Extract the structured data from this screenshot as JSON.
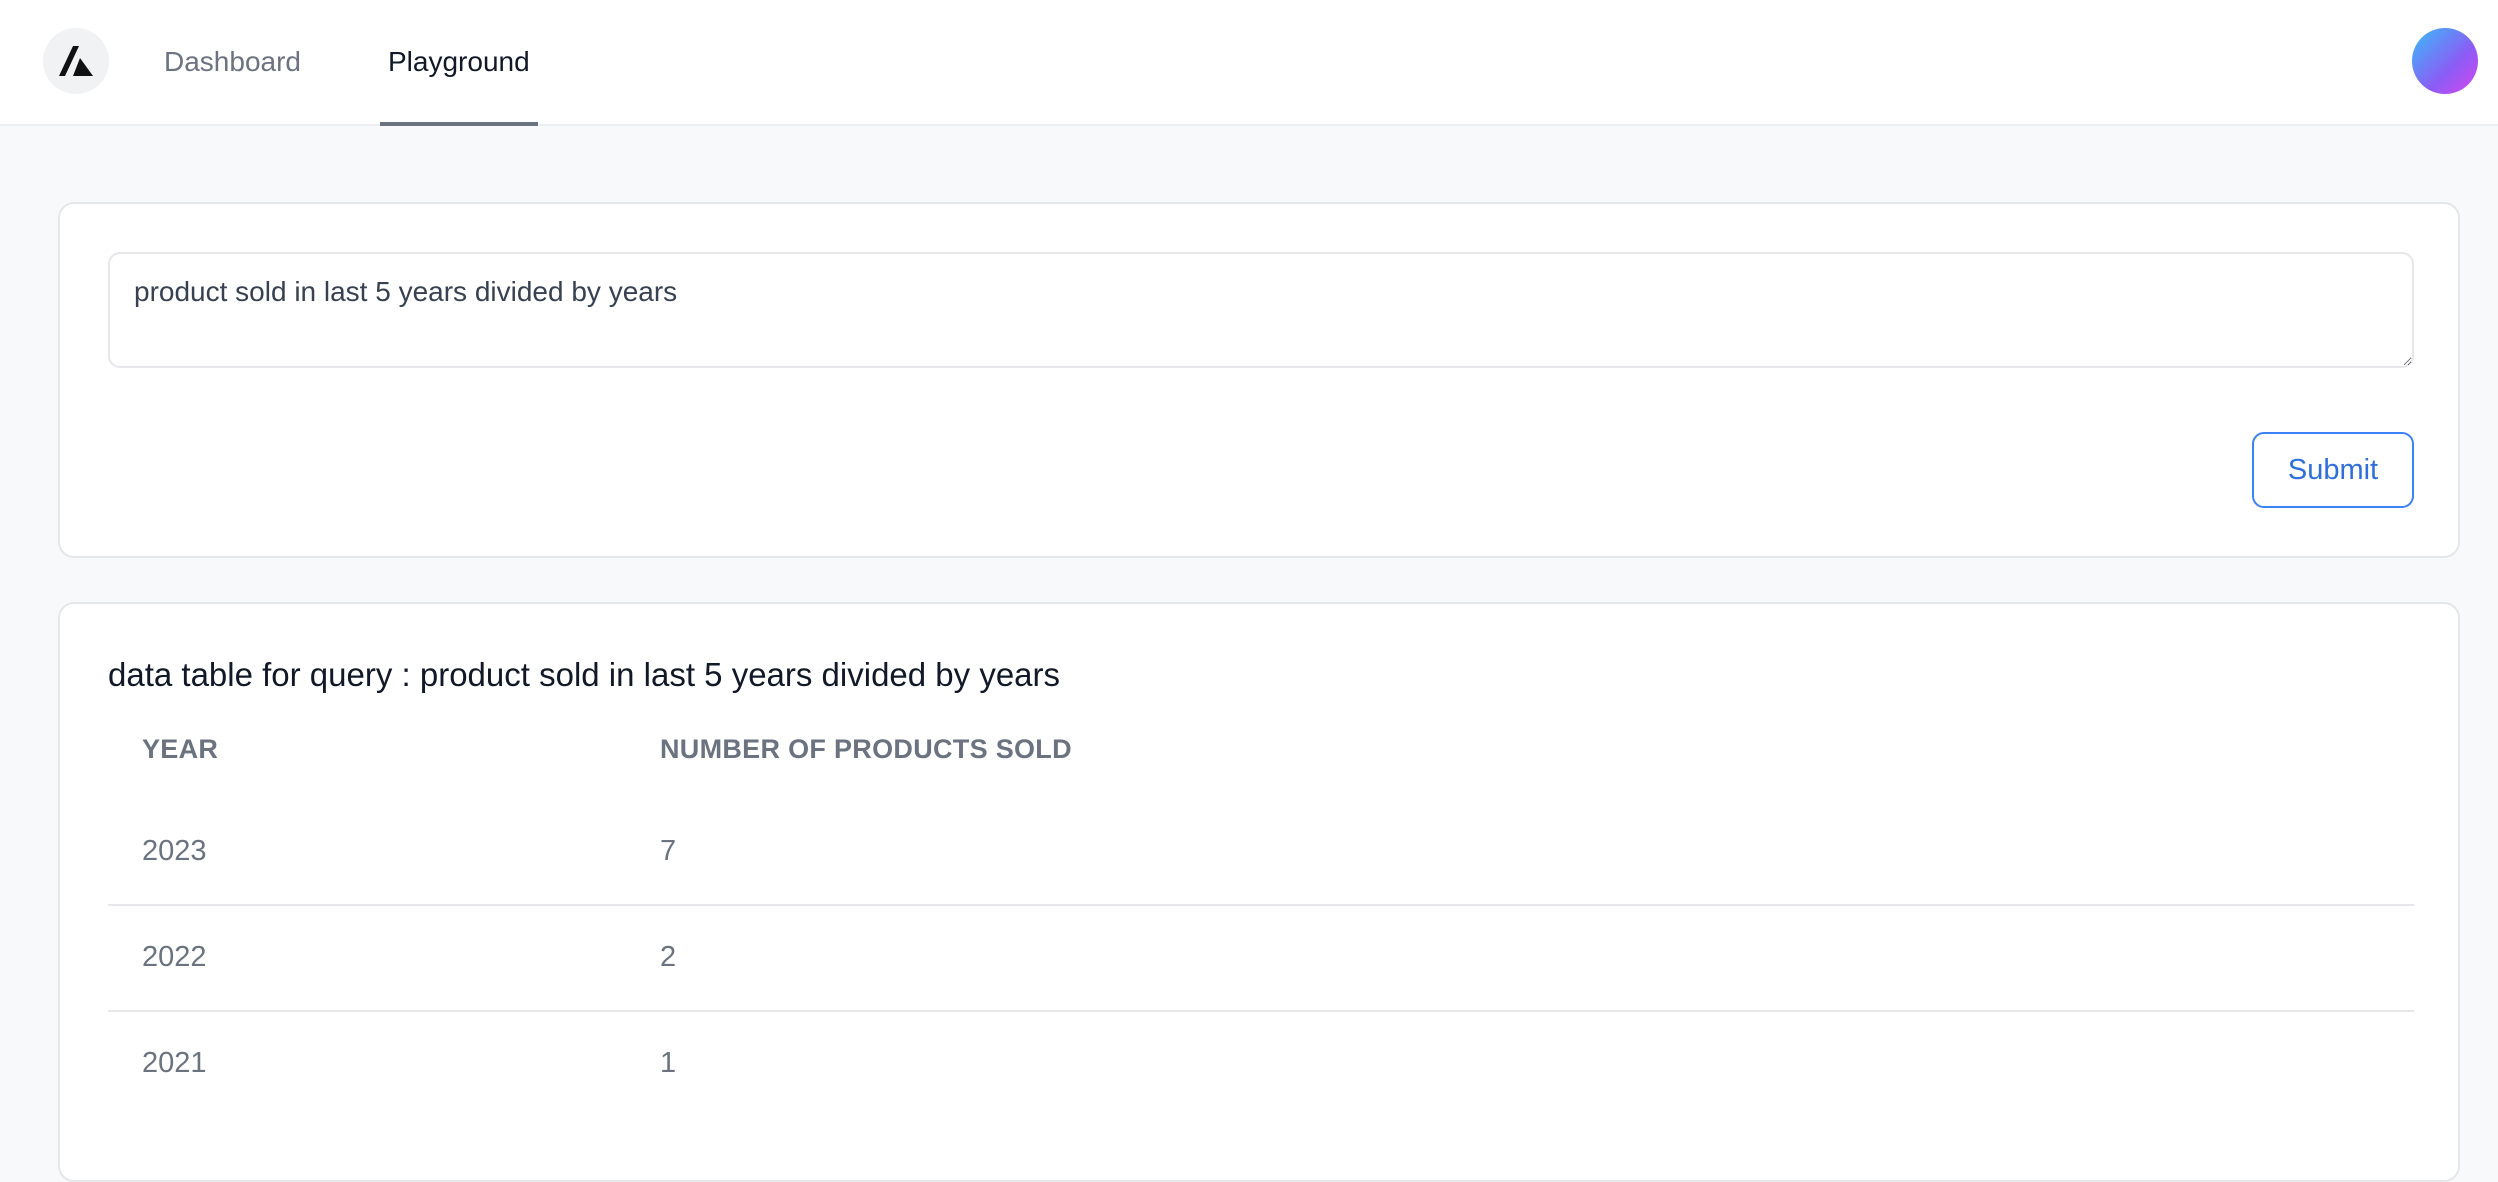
{
  "nav": {
    "tabs": [
      {
        "label": "Dashboard",
        "active": false
      },
      {
        "label": "Playground",
        "active": true
      }
    ]
  },
  "query": {
    "value": "product sold in last 5 years divided by years",
    "submit_label": "Submit"
  },
  "results": {
    "title": "data table for query : product sold in last 5 years divided by years",
    "columns": [
      "YEAR",
      "NUMBER OF PRODUCTS SOLD"
    ],
    "rows": [
      [
        "2023",
        "7"
      ],
      [
        "2022",
        "2"
      ],
      [
        "2021",
        "1"
      ]
    ]
  },
  "colors": {
    "accent": "#3b82f6",
    "background": "#f8f9fb"
  }
}
